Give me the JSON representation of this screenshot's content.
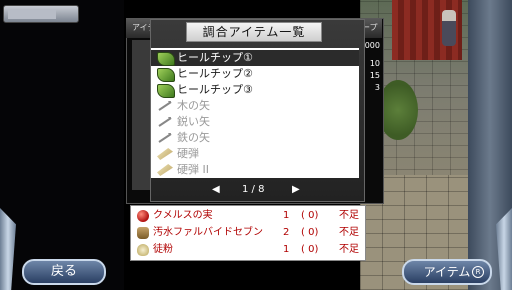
{
  "window": {
    "title": "調合アイテム一覧"
  },
  "background_tabs": {
    "left": "アイテ",
    "right": "ープ"
  },
  "side_numbers": [
    "000",
    "10",
    "15",
    "3"
  ],
  "list": {
    "items": [
      {
        "label": "ヒールチップ①",
        "icon": "green-chip-icon",
        "state": "selected"
      },
      {
        "label": "ヒールチップ②",
        "icon": "green-chip-icon",
        "state": "normal"
      },
      {
        "label": "ヒールチップ③",
        "icon": "green-chip-icon",
        "state": "normal"
      },
      {
        "label": "木の矢",
        "icon": "arrow-icon",
        "state": "disabled"
      },
      {
        "label": "鋭い矢",
        "icon": "arrow-icon",
        "state": "disabled"
      },
      {
        "label": "鉄の矢",
        "icon": "arrow-icon",
        "state": "disabled"
      },
      {
        "label": "硬弾",
        "icon": "bullet-icon",
        "state": "disabled"
      },
      {
        "label": "硬弾 II",
        "icon": "bullet-icon",
        "state": "disabled"
      }
    ]
  },
  "pager": {
    "prev": "◀",
    "text": "1 / 8",
    "next": "▶"
  },
  "requirements": [
    {
      "icon": "berry-icon",
      "name": "クメルスの実",
      "qty": "1",
      "owned": "( 0)",
      "status": "不足"
    },
    {
      "icon": "bottle-icon",
      "name": "汚水ファルバイドセブン",
      "qty": "2",
      "owned": "( 0)",
      "status": "不足"
    },
    {
      "icon": "powder-icon",
      "name": "徒粉",
      "qty": "1",
      "owned": "( 0)",
      "status": "不足"
    }
  ],
  "buttons": {
    "back": "戻る",
    "item": "アイテム",
    "item_badge": "R"
  },
  "colors": {
    "requirement_text": "#b00000",
    "selected_row": "#2b2b2b",
    "button": "#3a5680"
  }
}
